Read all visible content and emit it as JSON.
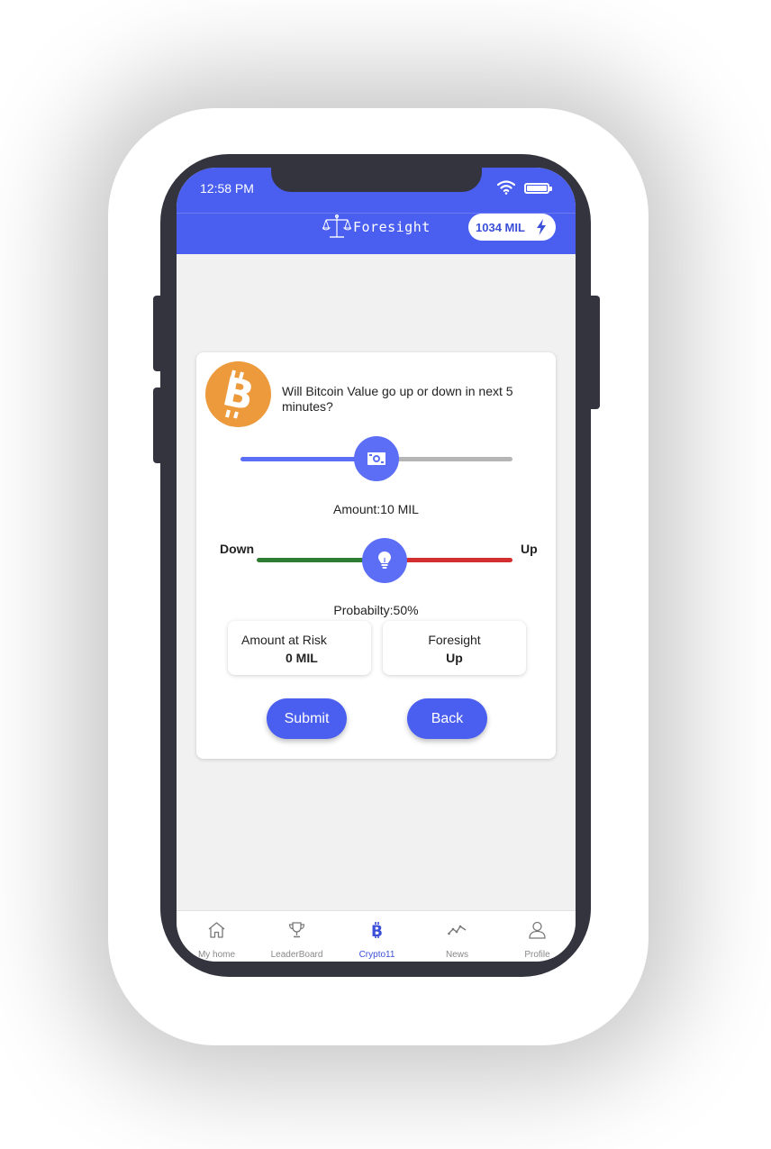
{
  "status_bar": {
    "time": "12:58 PM"
  },
  "app_bar": {
    "brand": "Foresight",
    "balance": "1034 MIL"
  },
  "question": {
    "text": "Will  Bitcoin Value go up or down in next 5 minutes?",
    "coin_icon": "bitcoin-icon"
  },
  "amount_slider": {
    "label": "Amount:10 MIL",
    "position": 0.5,
    "icon": "money-icon",
    "active_color": "#5b6ef5",
    "inactive_color": "#b5b5b5"
  },
  "probability_slider": {
    "left_label": "Down",
    "right_label": "Up",
    "label": "Probabilty:50%",
    "position": 0.5,
    "icon": "lightbulb-icon",
    "down_color": "#2e7d32",
    "up_color": "#d32f2f"
  },
  "stats": {
    "risk": {
      "title": "Amount at Risk",
      "value": "0 MIL"
    },
    "foresight": {
      "title": "Foresight",
      "value": "Up"
    }
  },
  "buttons": {
    "submit": "Submit",
    "back": "Back"
  },
  "tabs": [
    {
      "label": "My home",
      "icon": "home-icon"
    },
    {
      "label": "LeaderBoard",
      "icon": "trophy-icon"
    },
    {
      "label": "Crypto11",
      "icon": "bitcoin-icon",
      "active": true
    },
    {
      "label": "News",
      "icon": "trend-icon"
    },
    {
      "label": "Profile",
      "icon": "user-icon"
    }
  ],
  "colors": {
    "brand_blue": "#4a5ef0",
    "bitcoin_orange": "#f7931a"
  }
}
